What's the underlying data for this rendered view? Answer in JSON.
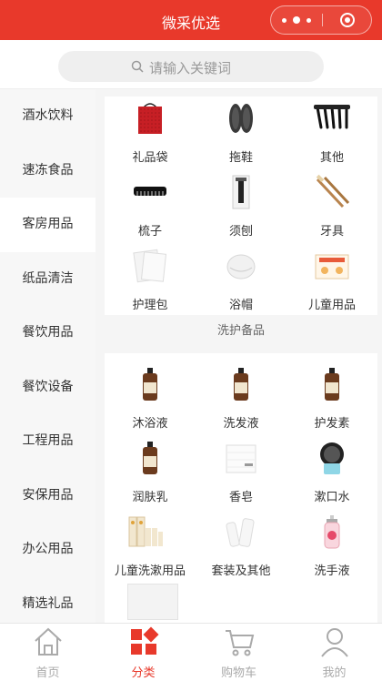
{
  "header": {
    "title": "微采优选"
  },
  "search": {
    "placeholder": "请输入关键词"
  },
  "sidebar": {
    "items": [
      {
        "label": "酒水饮料",
        "active": false
      },
      {
        "label": "速冻食品",
        "active": false
      },
      {
        "label": "客房用品",
        "active": true
      },
      {
        "label": "纸品清洁",
        "active": false
      },
      {
        "label": "餐饮用品",
        "active": false
      },
      {
        "label": "餐饮设备",
        "active": false
      },
      {
        "label": "工程用品",
        "active": false
      },
      {
        "label": "安保用品",
        "active": false
      },
      {
        "label": "办公用品",
        "active": false
      },
      {
        "label": "精选礼品",
        "active": false
      }
    ]
  },
  "content": {
    "group1": [
      {
        "label": "礼品袋",
        "icon": "gift-bag"
      },
      {
        "label": "拖鞋",
        "icon": "slippers"
      },
      {
        "label": "其他",
        "icon": "hangers"
      },
      {
        "label": "梳子",
        "icon": "comb"
      },
      {
        "label": "须刨",
        "icon": "razor"
      },
      {
        "label": "牙具",
        "icon": "toothbrush"
      },
      {
        "label": "护理包",
        "icon": "care-pack"
      },
      {
        "label": "浴帽",
        "icon": "shower-cap"
      },
      {
        "label": "儿童用品",
        "icon": "kids-pack"
      }
    ],
    "section_title": "洗护备品",
    "group2": [
      {
        "label": "沐浴液",
        "icon": "bottle"
      },
      {
        "label": "洗发液",
        "icon": "bottle"
      },
      {
        "label": "护发素",
        "icon": "bottle"
      },
      {
        "label": "润肤乳",
        "icon": "bottle"
      },
      {
        "label": "香皂",
        "icon": "soap"
      },
      {
        "label": "漱口水",
        "icon": "mouthwash"
      },
      {
        "label": "儿童洗漱用品",
        "icon": "kids-toiletries"
      },
      {
        "label": "套装及其他",
        "icon": "tubes"
      },
      {
        "label": "洗手液",
        "icon": "hand-soap"
      }
    ]
  },
  "tabbar": {
    "items": [
      {
        "label": "首页",
        "icon": "home-icon"
      },
      {
        "label": "分类",
        "icon": "category-icon"
      },
      {
        "label": "购物车",
        "icon": "cart-icon"
      },
      {
        "label": "我的",
        "icon": "profile-icon"
      }
    ]
  },
  "colors": {
    "brand": "#e8392b",
    "sidebar_bg": "#f7f7f7"
  }
}
